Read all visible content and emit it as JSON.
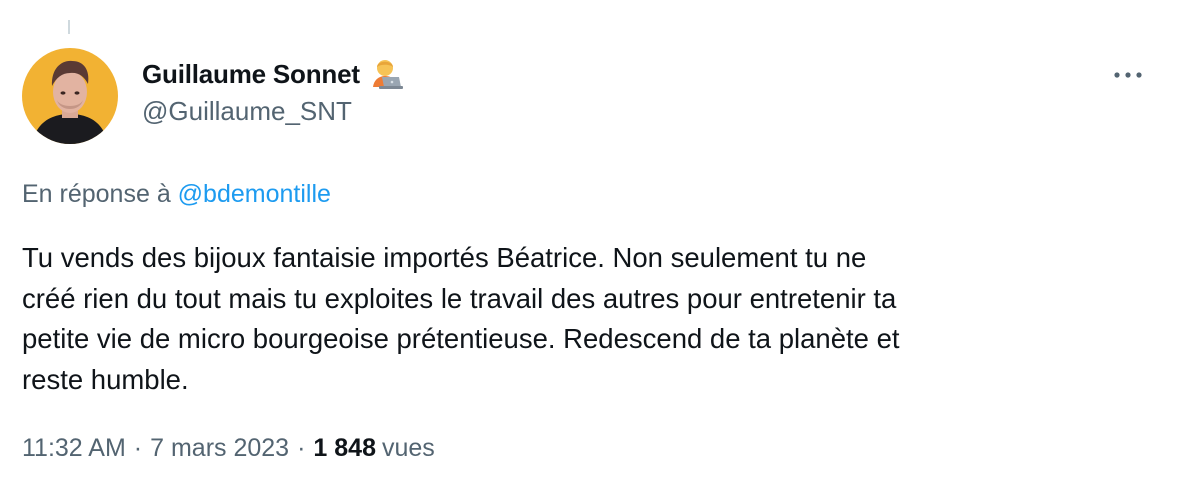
{
  "author": {
    "display_name": "Guillaume Sonnet",
    "badge_icon": "technologist-emoji-icon",
    "handle": "@Guillaume_SNT"
  },
  "reply": {
    "prefix": "En réponse à",
    "mention": "@bdemontille"
  },
  "tweet": {
    "text": "Tu vends des bijoux fantaisie importés Béatrice. Non seulement tu ne\ncréé rien du tout mais tu exploites le travail des autres pour entretenir ta\npetite vie de micro bourgeoise prétentieuse. Redescend de ta planète et\nreste humble."
  },
  "meta": {
    "time": "11:32 AM",
    "separator": "·",
    "date": "7 mars 2023",
    "views_count": "1 848",
    "views_label": "vues"
  },
  "colors": {
    "accent": "#1d9bf0",
    "text_primary": "#0f1419",
    "text_secondary": "#536471",
    "avatar_bg": "#f2b233"
  }
}
